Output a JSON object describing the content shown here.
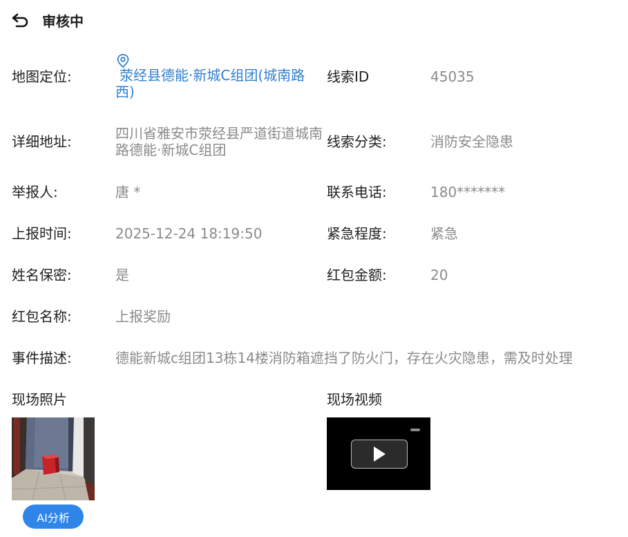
{
  "header": {
    "title": "审核中",
    "back_icon": "undo-arrow-icon"
  },
  "fields": {
    "location": {
      "label": "地图定位:",
      "value": "荥经县德能·新城C组团(城南路西)",
      "icon": "map-pin-icon"
    },
    "clue_id": {
      "label": "线索ID",
      "value": "45035"
    },
    "detail_address": {
      "label": "详细地址:",
      "value": "四川省雅安市荥经县严道街道城南路德能·新城C组团"
    },
    "clue_category": {
      "label": "线索分类:",
      "value": "消防安全隐患"
    },
    "reporter": {
      "label": "举报人:",
      "value": "唐 *"
    },
    "phone": {
      "label": "联系电话:",
      "value": "180*******"
    },
    "report_time": {
      "label": "上报时间:",
      "value": "2025-12-24 18:19:50"
    },
    "urgency": {
      "label": "紧急程度:",
      "value": "紧急"
    },
    "name_secret": {
      "label": "姓名保密:",
      "value": "是"
    },
    "red_packet_amount": {
      "label": "红包金额:",
      "value": "20"
    },
    "red_packet_name": {
      "label": "红包名称:",
      "value": "上报奖励"
    },
    "description": {
      "label": "事件描述:",
      "value": "德能新城c组团13栋14楼消防箱遮挡了防火门，存在火灾隐患，需及时处理"
    }
  },
  "media": {
    "photos_title": "现场照片",
    "videos_title": "现场视频",
    "ai_button": "AI分析"
  },
  "colors": {
    "link": "#2f7fd1",
    "value_text": "#8a8a8a",
    "label_text": "#1f1f1f",
    "accent_button": "#2f86e8"
  }
}
